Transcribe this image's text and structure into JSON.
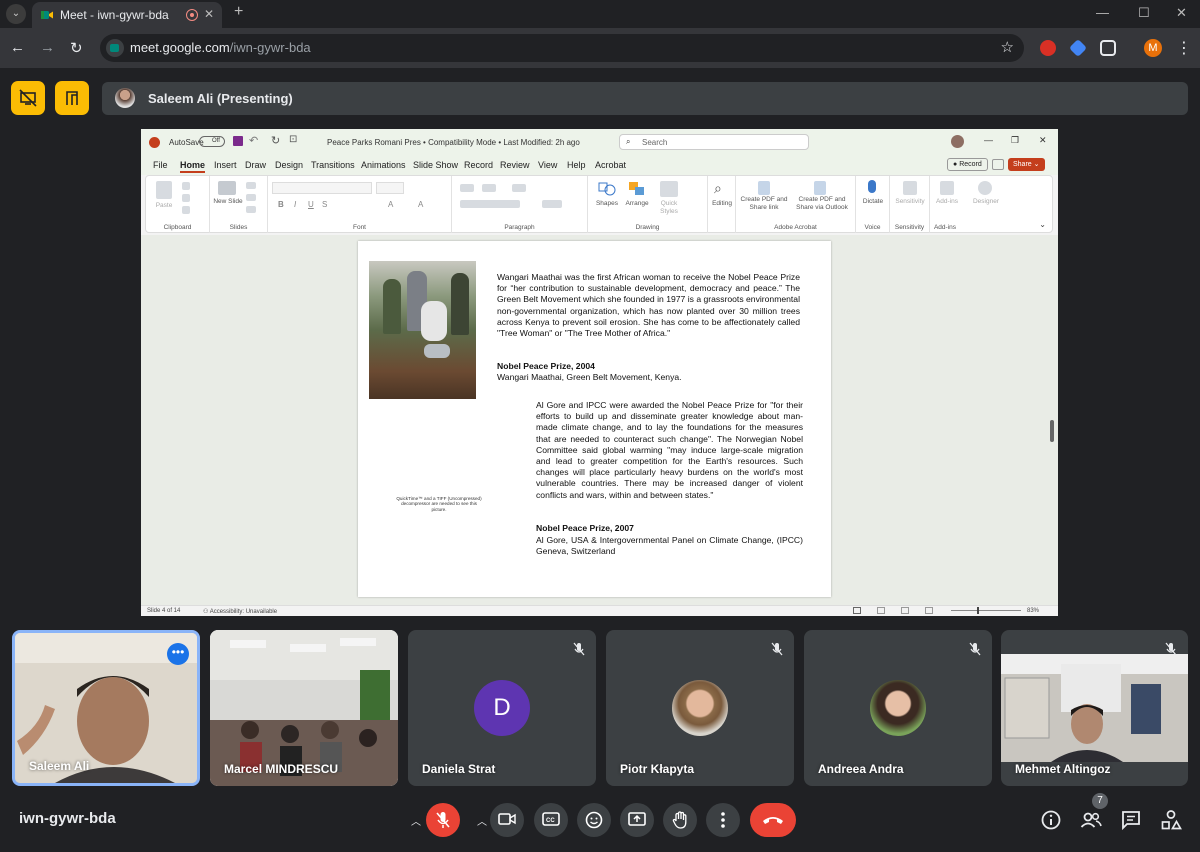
{
  "browser": {
    "tab_title": "Meet - iwn-gywr-bda",
    "url_host": "meet.google.com",
    "url_path": "/iwn-gywr-bda",
    "profile_initial": "M"
  },
  "presenter": {
    "name": "Saleem Ali (Presenting)"
  },
  "ppt": {
    "autosave_label": "AutoSave",
    "autosave_state": "Off",
    "doc_title": "Peace Parks Romani Pres  •  Compatibility Mode  •  Last Modified: 2h ago",
    "search_placeholder": "Search",
    "tabs": [
      "File",
      "Home",
      "Insert",
      "Draw",
      "Design",
      "Transitions",
      "Animations",
      "Slide Show",
      "Record",
      "Review",
      "View",
      "Help",
      "Acrobat"
    ],
    "record_label": "Record",
    "share_label": "Share",
    "ribbon": {
      "paste": "Paste",
      "new_slide": "New Slide",
      "shapes": "Shapes",
      "arrange": "Arrange",
      "quick_styles": "Quick Styles",
      "editing": "Editing",
      "create_pdf_share": "Create PDF and Share link",
      "create_pdf_outlook": "Create PDF and Share via Outlook",
      "dictate": "Dictate",
      "sensitivity": "Sensitivity",
      "add_ins": "Add-ins",
      "designer": "Designer",
      "groups": [
        "Clipboard",
        "Slides",
        "Font",
        "Paragraph",
        "Drawing",
        "Adobe Acrobat",
        "Voice",
        "Sensitivity",
        "Add-ins"
      ]
    },
    "slide": {
      "para1": "Wangari Maathai was the first African woman to receive the Nobel Peace Prize for “her contribution to sustainable development, democracy and peace.” The Green Belt Movement which she founded in 1977 is a grassroots environmental non-governmental organization, which has now planted over 30 million trees across Kenya to prevent soil erosion. She has come to be affectionately called \"Tree Woman\" or \"The Tree Mother of Africa.\"",
      "prize1_title": "Nobel Peace Prize, 2004",
      "prize1_text": "Wangari Maathai, Green Belt Movement, Kenya.",
      "para2": "Al Gore and IPCC were awarded the Nobel Peace Prize for \"for their efforts to build up and disseminate greater knowledge about man-made climate change, and to lay the foundations for the measures that are needed to counteract such change\". The Norwegian Nobel Committee said global warming \"may induce large-scale migration and lead to greater competition for the Earth's resources. Such changes will place particularly heavy burdens on the world's most vulnerable countries. There may be increased danger of violent conflicts and wars, within and between states.\"",
      "prize2_title": "Nobel Peace Prize, 2007",
      "prize2_text": "Al Gore, USA & Intergovernmental Panel on Climate Change, (IPCC) Geneva, Switzerland",
      "missing_image": "QuickTime™ and a TIFF (Uncompressed) decompressor are needed to see this picture."
    },
    "status_slide": "Slide 4 of 14",
    "status_accessibility": "Accessibility: Unavailable",
    "zoom": "83%"
  },
  "participants": [
    {
      "name": "Saleem Ali",
      "speaking": true
    },
    {
      "name": "Marcel MINDRESCU"
    },
    {
      "name": "Daniela Strat",
      "initial": "D"
    },
    {
      "name": "Piotr Kłapyta"
    },
    {
      "name": "Andreea Andra"
    },
    {
      "name": "Mehmet Altingoz"
    }
  ],
  "footer": {
    "meeting_code": "iwn-gywr-bda",
    "people_count": "7"
  },
  "colors": {
    "accent_yellow": "#fbbc04",
    "end_call_red": "#ea4335",
    "speaking_blue": "#8ab4f8"
  }
}
